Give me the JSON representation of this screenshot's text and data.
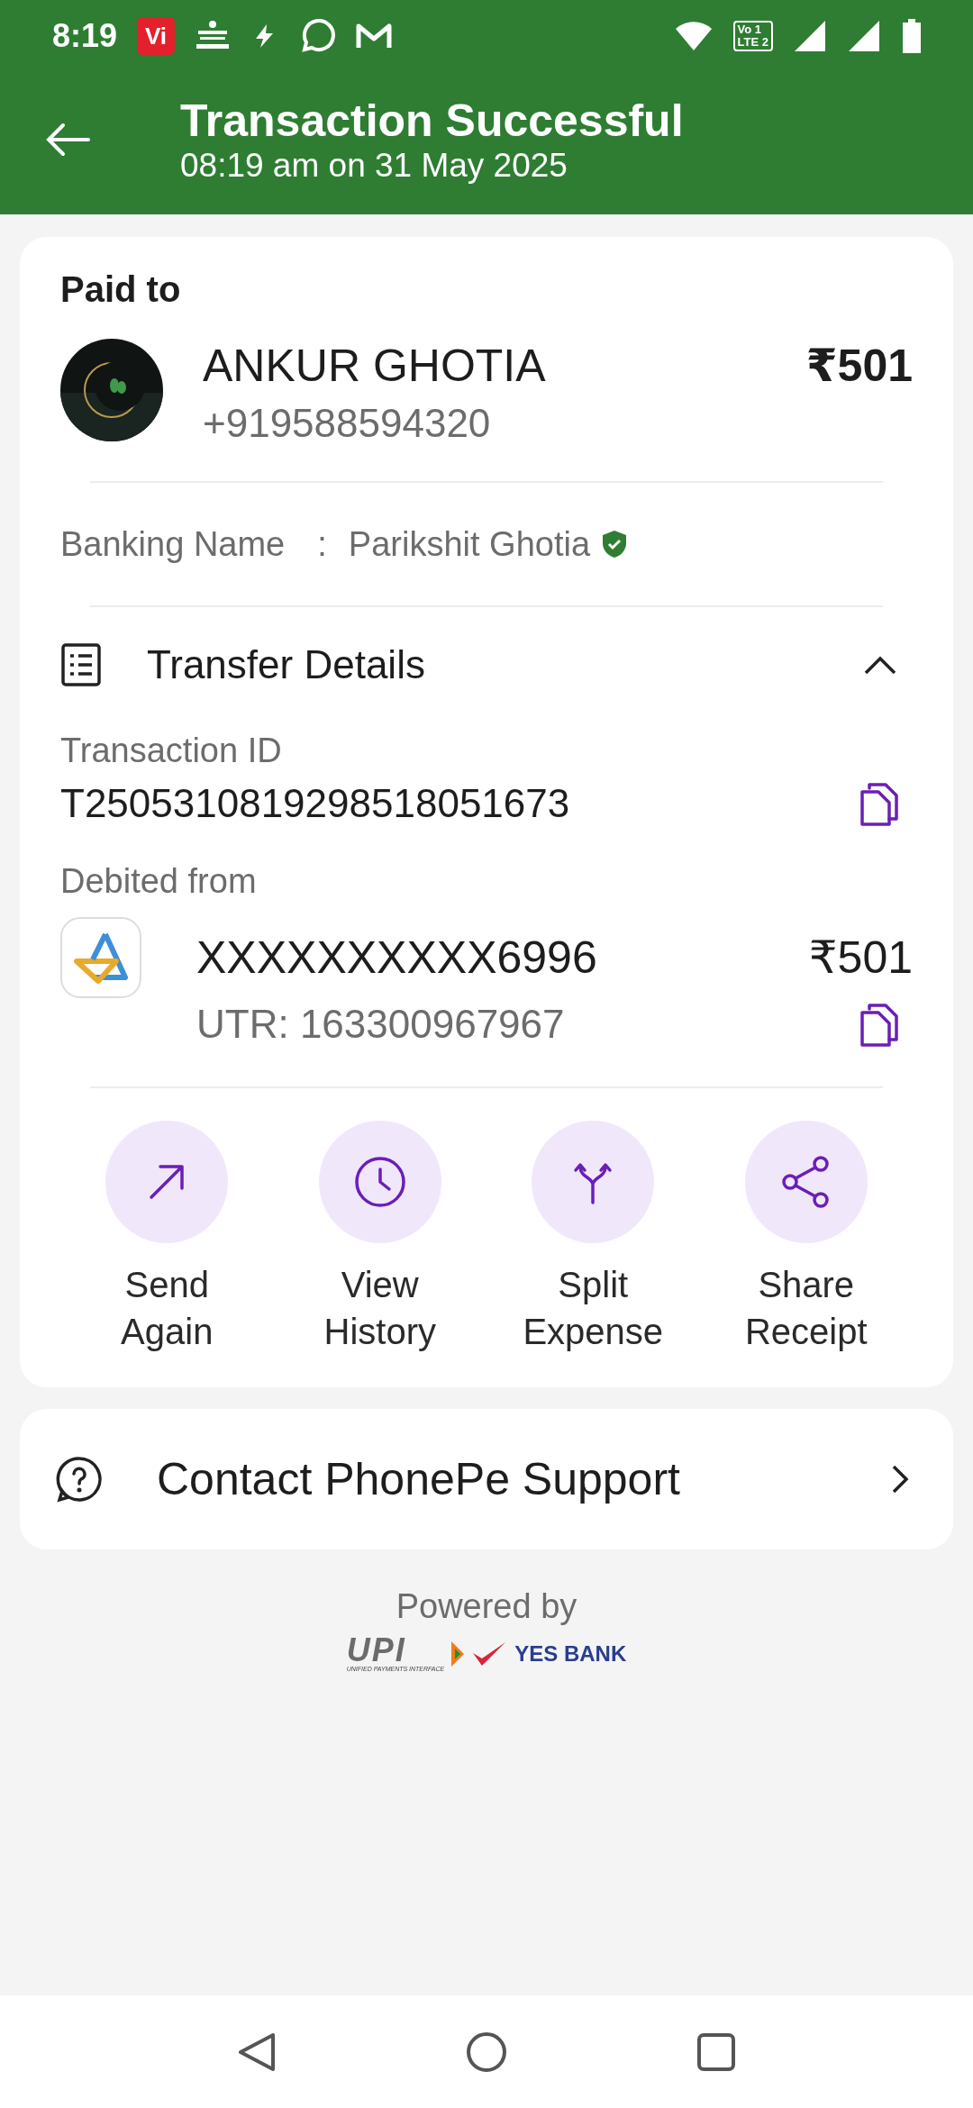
{
  "status_bar": {
    "time": "8:19",
    "carrier_badge": "Vi",
    "network_badge": [
      "Vo 1",
      "LTE 2"
    ]
  },
  "header": {
    "title": "Transaction Successful",
    "subtitle": "08:19 am on 31 May 2025"
  },
  "payee": {
    "section_title": "Paid to",
    "name": "ANKUR GHOTIA",
    "phone": "+919588594320",
    "amount": "₹501",
    "banking_label": "Banking Name",
    "separator": ":",
    "banking_name": "Parikshit Ghotia",
    "verified": true
  },
  "transfer": {
    "title": "Transfer Details",
    "expanded": true,
    "transaction_label": "Transaction ID",
    "transaction_id": "T2505310819298518051673",
    "debited_label": "Debited from",
    "account": "XXXXXXXXXX6996",
    "amount": "₹501",
    "utr": "UTR: 163300967967"
  },
  "actions": [
    {
      "kind": "send",
      "label": "Send Again"
    },
    {
      "kind": "history",
      "label": "View History"
    },
    {
      "kind": "split",
      "label": "Split Expense"
    },
    {
      "kind": "share",
      "label": "Share Receipt"
    }
  ],
  "support": {
    "label": "Contact PhonePe Support"
  },
  "footer": {
    "powered_by": "Powered by",
    "upi": "UPI",
    "upi_tagline": "UNIFIED PAYMENTS INTERFACE",
    "bank": "YES BANK"
  }
}
